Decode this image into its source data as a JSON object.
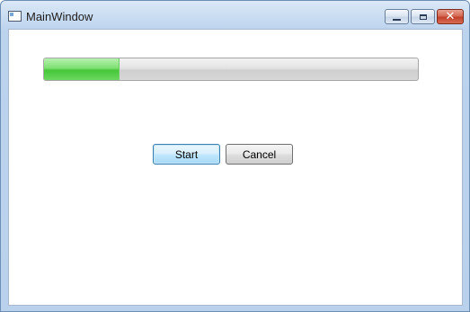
{
  "window": {
    "title": "MainWindow"
  },
  "progress": {
    "value_percent": 20
  },
  "buttons": {
    "start_label": "Start",
    "cancel_label": "Cancel"
  },
  "icons": {
    "app": "window-icon",
    "minimize": "minimize-icon",
    "maximize": "maximize-icon",
    "close": "close-icon"
  },
  "colors": {
    "progress_fill": "#45c739",
    "close_button": "#c2412b"
  }
}
